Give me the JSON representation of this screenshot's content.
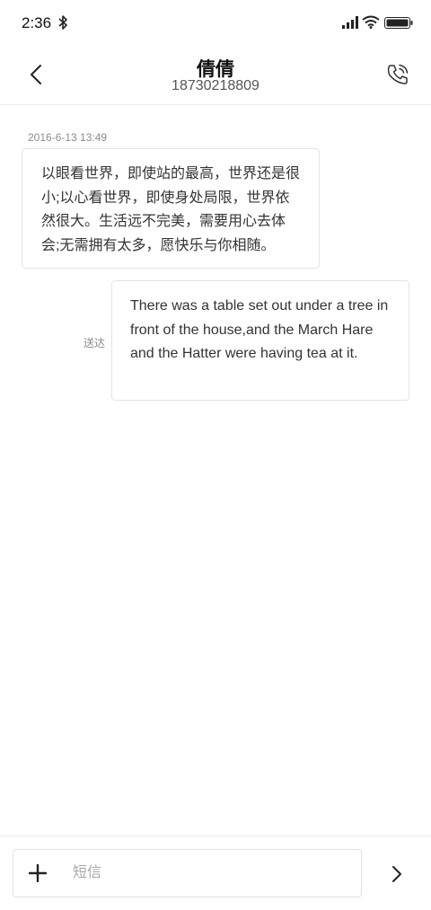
{
  "status_bar": {
    "time": "2:36"
  },
  "header": {
    "title": "倩倩",
    "subtitle": "18730218809"
  },
  "conversation": {
    "timestamp": "2016-6-13 13:49",
    "messages": [
      {
        "direction": "incoming",
        "text": "以眼看世界，即使站的最高，世界还是很小;以心看世界，即使身处局限，世界依然很大。生活远不完美，需要用心去体会;无需拥有太多，愿快乐与你相随。"
      },
      {
        "direction": "outgoing",
        "text": "There was a table set out under a tree in front of the house,and the March Hare and the Hatter were having tea at it.",
        "status": "送达"
      }
    ]
  },
  "compose": {
    "placeholder": "短信"
  },
  "icons": {
    "back": "chevron-left-icon",
    "call": "phone-icon",
    "add": "plus-icon",
    "send": "chevron-right-icon"
  },
  "colors": {
    "text_primary": "#111111",
    "text_secondary": "#8c8c8c",
    "bubble_border": "#e4e4e4"
  }
}
